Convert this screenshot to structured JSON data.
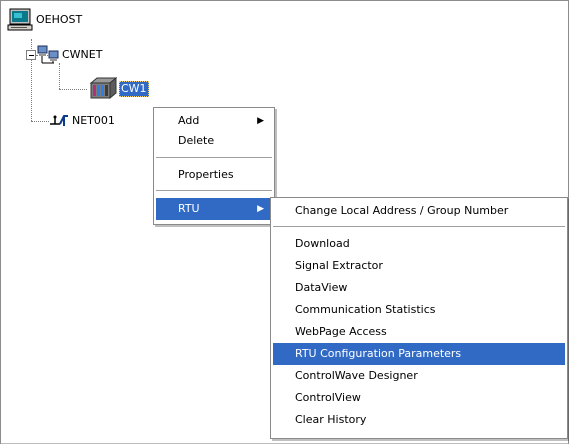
{
  "tree": {
    "root": {
      "label": "OEHOST",
      "icon": "computer-icon"
    },
    "network": {
      "label": "CWNET",
      "icon": "network-computers-icon"
    },
    "device": {
      "label": "CW1",
      "icon": "rtu-device-icon"
    },
    "net2": {
      "label": "NET001",
      "icon": "network-connection-icon"
    }
  },
  "context_menu": {
    "items": [
      "Add",
      "Delete",
      "Properties",
      "RTU"
    ],
    "submenu_arrow": "▶"
  },
  "rtu_submenu": {
    "items": [
      "Change Local Address / Group Number",
      "Download",
      "Signal Extractor",
      "DataView",
      "Communication Statistics",
      "WebPage Access",
      "RTU Configuration Parameters",
      "ControlWave Designer",
      "ControlView",
      "Clear History"
    ],
    "highlighted": "RTU Configuration Parameters"
  },
  "colors": {
    "selection": "#316ac5"
  }
}
